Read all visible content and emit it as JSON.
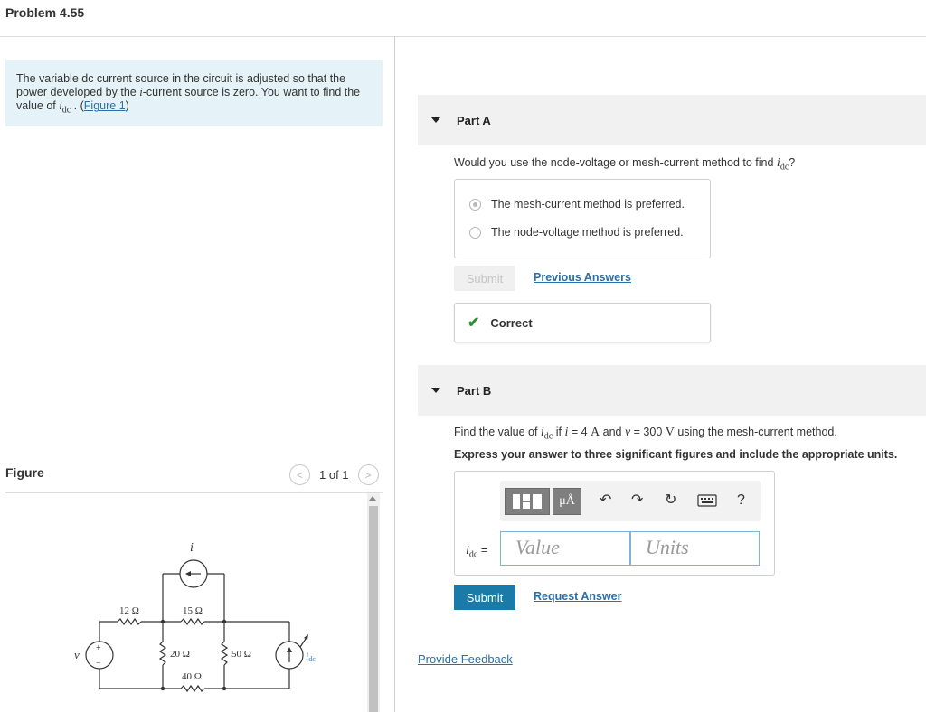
{
  "problem": {
    "title": "Problem 4.55"
  },
  "intro": {
    "text_before": "The variable dc current source in the circuit is adjusted so that the power developed by the ",
    "var_i": "i",
    "text_middle": "-current source is zero. You want to find the value of ",
    "var_idc": "i",
    "var_idc_sub": "dc",
    "text_after": " . (",
    "figure_link": "Figure 1",
    "text_close": ")"
  },
  "figure": {
    "label": "Figure",
    "pager_text": "1 of 1",
    "prev_glyph": "<",
    "next_glyph": ">",
    "circuit": {
      "r12": "12 Ω",
      "r15": "15 Ω",
      "r20": "20 Ω",
      "r50": "50 Ω",
      "r40": "40 Ω",
      "i_label": "i",
      "v_label": "v",
      "idc_label": "i",
      "idc_sub": "dc",
      "plus": "+",
      "minus": "−"
    }
  },
  "part_a": {
    "title": "Part A",
    "question_before": "Would you use the node-voltage or mesh-current method to find ",
    "question_var": "i",
    "question_sub": "dc",
    "question_after": "?",
    "options": [
      {
        "label": "The mesh-current method is preferred.",
        "selected": true
      },
      {
        "label": "The node-voltage method is preferred.",
        "selected": false
      }
    ],
    "submit_label": "Submit",
    "previous_answers_label": "Previous Answers",
    "result_icon": "check-icon",
    "result_text": "Correct",
    "result_color": "#2e8b2e"
  },
  "part_b": {
    "title": "Part B",
    "q_before": "Find the value of ",
    "q_var": "i",
    "q_sub": "dc",
    "q_mid1": " if ",
    "q_i": "i",
    "q_eq1": " = 4 ",
    "q_unit_a": "A",
    "q_and": " and ",
    "q_v": "v",
    "q_eq2": " = 300 ",
    "q_unit_v": "V",
    "q_end": " using the mesh-current method.",
    "instruction": "Express your answer to three significant figures and include the appropriate units.",
    "toolbar": {
      "template_icon": "templates-icon",
      "units_label": "μÅ",
      "undo_icon": "undo-icon",
      "redo_icon": "redo-icon",
      "reset_icon": "reset-icon",
      "keyboard_icon": "keyboard-icon",
      "help_label": "?"
    },
    "variable": "i",
    "variable_sub": "dc",
    "equals": " =",
    "value_placeholder": "Value",
    "units_placeholder": "Units",
    "submit_label": "Submit",
    "request_answer_label": "Request Answer"
  },
  "footer": {
    "provide_feedback_label": "Provide Feedback"
  },
  "colors": {
    "accent_blue": "#1a7aa8",
    "link_blue": "#2a6fa8",
    "intro_bg": "#e5f3f8",
    "part_header_bg": "#f1f1f1"
  }
}
